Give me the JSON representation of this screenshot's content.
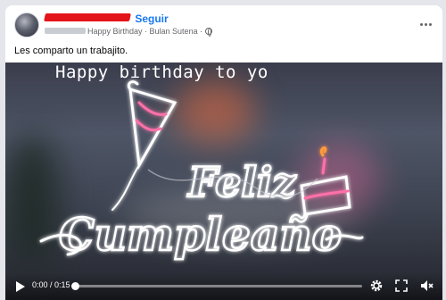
{
  "post": {
    "author_suffix": "Seguir",
    "meta_text": "Happy Birthday · Bulan Sutena ·",
    "caption": "Les comparto un trabajito."
  },
  "video": {
    "overlay_text": "Happy birthday to yo",
    "sign_text_1": "Feliz",
    "sign_text_2": "Cumpleaño",
    "time_label": "0:00 / 0:15",
    "progress": 0.0
  },
  "icons": {
    "avatar": "avatar",
    "more": "more-horizontal-icon",
    "privacy": "globe-icon",
    "play": "play-icon",
    "settings": "gear-icon",
    "fullscreen": "fullscreen-icon",
    "volume": "volume-muted-icon"
  },
  "colors": {
    "follow": "#1877f2",
    "redaction": "#e4141b",
    "neon_white": "#ffffff",
    "neon_pink": "#ff5fa2"
  }
}
